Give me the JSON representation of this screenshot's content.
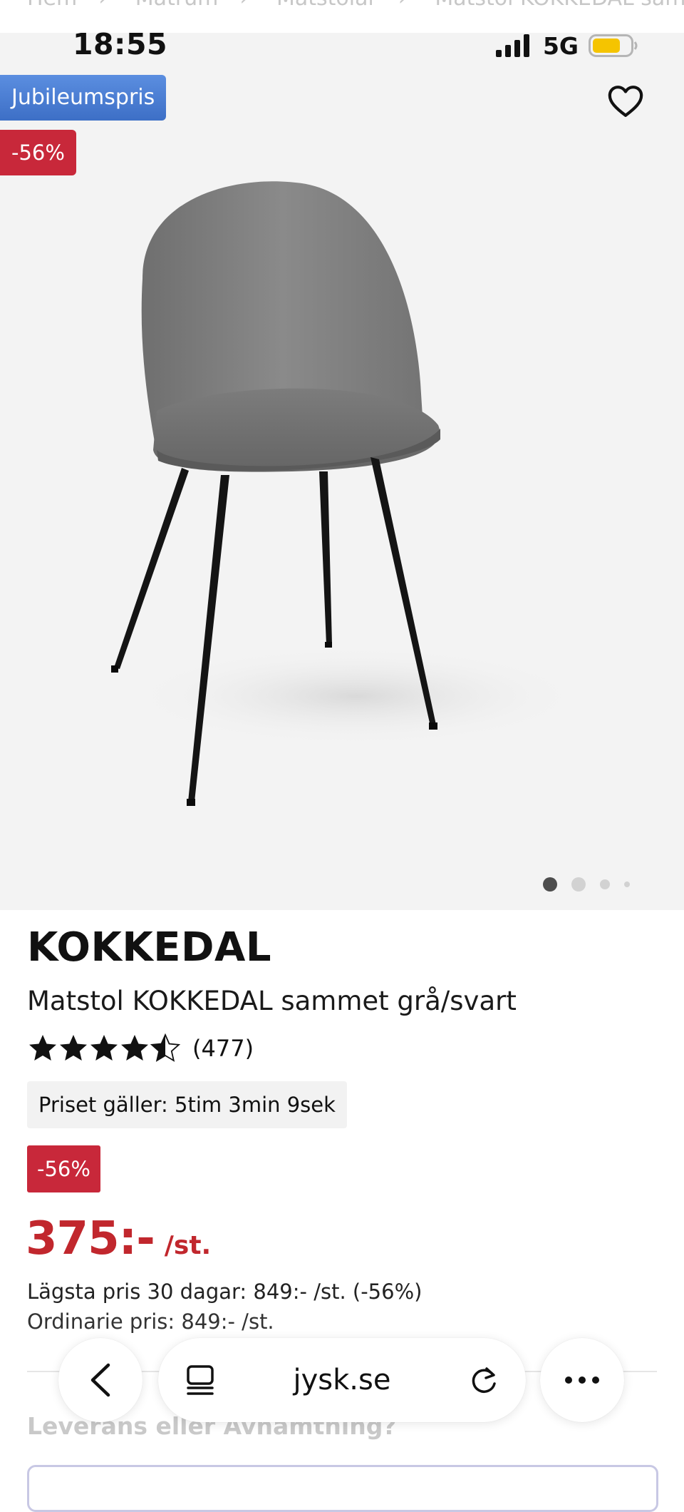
{
  "breadcrumb": [
    "Hem",
    "Matrum",
    "Matstolar",
    "Matstol KOKKEDAL sammet gr"
  ],
  "status_bar": {
    "time": "18:55",
    "network": "5G",
    "icons": [
      "signal-icon",
      "battery-icon"
    ],
    "battery_color": "#f5c400"
  },
  "badges": {
    "campaign": "Jubileumspris",
    "discount_image": "-56%",
    "campaign_color": "#4a7bd0",
    "discount_color": "#c8283a"
  },
  "gallery": {
    "image_subject": "grey velvet dining chair with black metal legs",
    "dot_count": 4,
    "active_index": 0
  },
  "product": {
    "brand": "KOKKEDAL",
    "title": "Matstol KOKKEDAL sammet grå/svart",
    "rating": 4.5,
    "rating_max": 5,
    "review_count": "(477)",
    "timer_text": "Priset gäller: 5tim 3min 9sek",
    "discount": "-56%",
    "price": "375:-",
    "price_unit": "/st.",
    "price_color": "#c1272d",
    "lowest_price": "Lägsta pris 30 dagar: 849:- /st. (-56%)",
    "ordinary_price": "Ordinarie pris: 849:- /st."
  },
  "delivery": {
    "heading": "Leverans eller Avhämtning?"
  },
  "browser_bar": {
    "address": "jysk.se",
    "icons": [
      "back-icon",
      "tabs-icon",
      "reload-icon",
      "more-icon"
    ]
  }
}
